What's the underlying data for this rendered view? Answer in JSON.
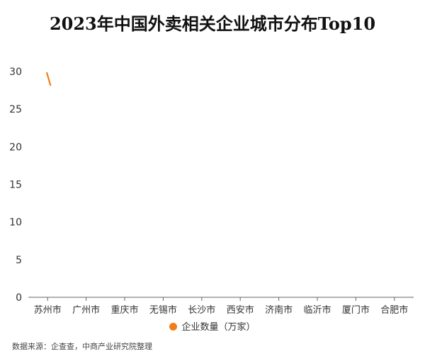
{
  "chart_data": {
    "type": "line",
    "title": "2023年中国外卖相关企业城市分布Top10",
    "categories": [
      "苏州市",
      "广州市",
      "重庆市",
      "无锡市",
      "长沙市",
      "西安市",
      "济南市",
      "临沂市",
      "厦门市",
      "合肥市"
    ],
    "series": [
      {
        "name": "企业数量（万家）",
        "values": [
          28.2
        ],
        "color": "#f07d19"
      }
    ],
    "ylim": [
      0,
      30
    ],
    "yticks": [
      0,
      5,
      10,
      15,
      20,
      25,
      30
    ],
    "grid": false,
    "legend": "bottom"
  },
  "source": "数据来源：企查查，中商产业研究院整理"
}
